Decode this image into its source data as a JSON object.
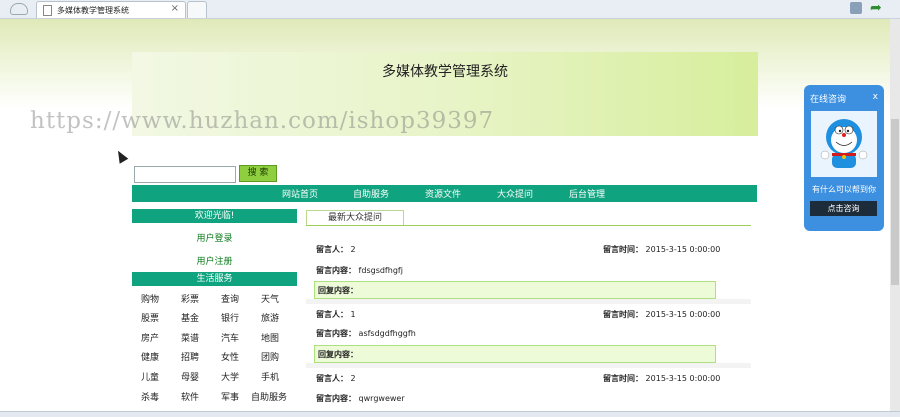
{
  "browser": {
    "tab_title": "多媒体教学管理系统",
    "tab_close": "×"
  },
  "header": {
    "title": "多媒体教学管理系统"
  },
  "watermark": "https://www.huzhan.com/ishop39397",
  "search": {
    "value": "",
    "button_label": "搜 索"
  },
  "nav": {
    "items": [
      "网站首页",
      "自助服务",
      "资源文件",
      "大众提问",
      "后台管理"
    ]
  },
  "sidebar": {
    "welcome_title": "欢迎光临!",
    "login_link": "用户登录",
    "register_link": "用户注册",
    "services_title": "生活服务",
    "services": [
      [
        "购物",
        "彩票",
        "查询",
        "天气"
      ],
      [
        "股票",
        "基金",
        "银行",
        "旅游"
      ],
      [
        "房产",
        "菜谱",
        "汽车",
        "地图"
      ],
      [
        "健康",
        "招聘",
        "女性",
        "团购"
      ],
      [
        "儿童",
        "母婴",
        "大学",
        "手机"
      ],
      [
        "杀毒",
        "软件",
        "军事",
        "自助服务"
      ]
    ]
  },
  "content": {
    "tab_label": "最新大众提问",
    "author_label": "留言人：",
    "time_label": "留言时间：",
    "content_label": "留言内容：",
    "reply_label": "回复内容：",
    "messages": [
      {
        "author": "2",
        "time": "2015-3-15 0:00:00",
        "content": "fdsgsdfhgfj"
      },
      {
        "author": "1",
        "time": "2015-3-15 0:00:00",
        "content": "asfsdgdfhggfh"
      },
      {
        "author": "2",
        "time": "2015-3-15 0:00:00",
        "content": "qwrgwewer"
      }
    ]
  },
  "consult": {
    "title": "在线咨询",
    "close": "x",
    "text": "有什么可以帮到你",
    "button_label": "点击咨询",
    "accent": "#3d8fe0"
  },
  "colors": {
    "nav_green": "#0fa37f",
    "reply_bg": "#eefbd9"
  }
}
